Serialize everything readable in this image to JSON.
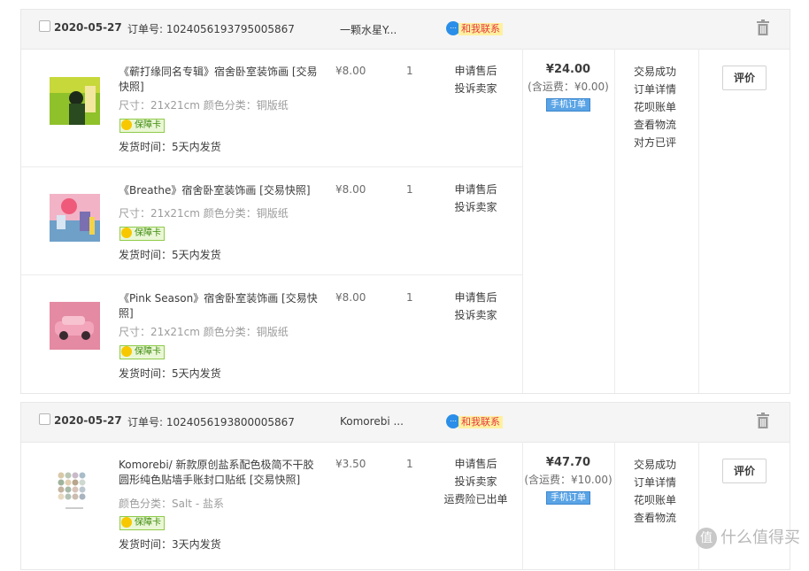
{
  "orders": [
    {
      "date": "2020-05-27",
      "order_no": "订单号: 1024056193795005867",
      "shop": "一颗水星Y...",
      "contact": "和我联系",
      "items": [
        {
          "title": "《蕲打缘同名专辑》宿舍卧室装饰画 [交易快照]",
          "spec": "尺寸：21x21cm  颜色分类：铜版纸",
          "badge": "保障卡",
          "ship": "发货时间：5天内发货",
          "price": "¥8.00",
          "qty": "1",
          "svc": [
            "申请售后",
            "投诉卖家"
          ]
        },
        {
          "title": "《Breathe》宿舍卧室装饰画 [交易快照]",
          "spec": "尺寸：21x21cm  颜色分类：铜版纸",
          "badge": "保障卡",
          "ship": "发货时间：5天内发货",
          "price": "¥8.00",
          "qty": "1",
          "svc": [
            "申请售后",
            "投诉卖家"
          ]
        },
        {
          "title": "《Pink Season》宿舍卧室装饰画 [交易快照]",
          "spec": "尺寸：21x21cm  颜色分类：铜版纸",
          "badge": "保障卡",
          "ship": "发货时间：5天内发货",
          "price": "¥8.00",
          "qty": "1",
          "svc": [
            "申请售后",
            "投诉卖家"
          ]
        }
      ],
      "total": "¥24.00",
      "fee": "(含运费：¥0.00)",
      "mobile": "手机订单",
      "status": [
        "交易成功",
        "订单详情",
        "花呗账单",
        "查看物流",
        "对方已评"
      ],
      "review": "评价"
    },
    {
      "date": "2020-05-27",
      "order_no": "订单号: 1024056193800005867",
      "shop": "Komorebi ...",
      "contact": "和我联系",
      "items": [
        {
          "title": "Komorebi/ 新款原创盐系配色极简不干胶圆形纯色贴墙手账封口贴纸 [交易快照]",
          "spec": "颜色分类：Salt - 盐系",
          "badge": "保障卡",
          "ship": "发货时间：3天内发货",
          "price": "¥3.50",
          "qty": "1",
          "svc": [
            "申请售后",
            "投诉卖家",
            "运费险已出单"
          ]
        }
      ],
      "total": "¥47.70",
      "fee": "(含运费：¥10.00)",
      "mobile": "手机订单",
      "status": [
        "交易成功",
        "订单详情",
        "花呗账单",
        "查看物流"
      ],
      "review": "评价"
    }
  ],
  "watermark": "什么值得买",
  "colors": {
    "accent_red": "#e4393c",
    "header_bg": "#f5f5f5",
    "badge_green": "#8fcb4a",
    "mobile_blue": "#5aa4e6"
  }
}
